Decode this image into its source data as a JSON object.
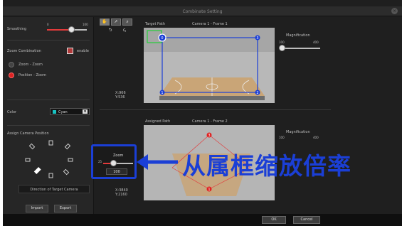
{
  "window": {
    "title": "Combinate Setting",
    "close_glyph": "×"
  },
  "left": {
    "smoothing": {
      "label": "Smoothing",
      "min": "0",
      "max": "100",
      "value_fraction": 0.62
    },
    "zoom_combination": {
      "label": "Zoom Combination",
      "enable_label": "enable",
      "enabled": true
    },
    "modes": [
      {
        "label": "Zoom - Zoom",
        "selected": false
      },
      {
        "label": "Position - Zoom",
        "selected": true
      }
    ],
    "color": {
      "label": "Color",
      "value": "Cyan",
      "swatch": "#19c3c3"
    },
    "assign_camera_position": {
      "label": "Assign Camera Position",
      "direction_caption": "Direction of Target Camera"
    },
    "import_label": "Import",
    "export_label": "Export"
  },
  "toolbar": {
    "hand_icon": "hand-icon",
    "pointer_icon": "pointer-icon",
    "magnify_icon": "magnify-icon",
    "undo_glyph": "⮌",
    "redo_glyph": "⮎"
  },
  "coords_top": {
    "x": "X:966",
    "y": "Y:536"
  },
  "coords_bottom": {
    "x": "X:3840",
    "y": "Y:2160"
  },
  "target_panel": {
    "title": "Target Path",
    "frame": "Camera 1 - Frame 1",
    "mag_label": "Magnification",
    "mag_min": "100",
    "mag_max": "400",
    "mag_fraction": 0.05,
    "points": [
      "0",
      "3",
      "1",
      "2"
    ]
  },
  "assigned_panel": {
    "title": "Assigned Path",
    "frame": "Camera 1 - Frame 2",
    "mag_label": "Magnification",
    "mag_min": "100",
    "mag_max": "400",
    "points": [
      "3",
      "1"
    ]
  },
  "zoom_popup": {
    "label": "Zoom",
    "min": "25",
    "value": "100",
    "fraction": 0.35
  },
  "annotation": {
    "text": "从属框缩放倍率",
    "color": "#1b3fd6"
  },
  "footer": {
    "ok": "OK",
    "cancel": "Cancel"
  }
}
